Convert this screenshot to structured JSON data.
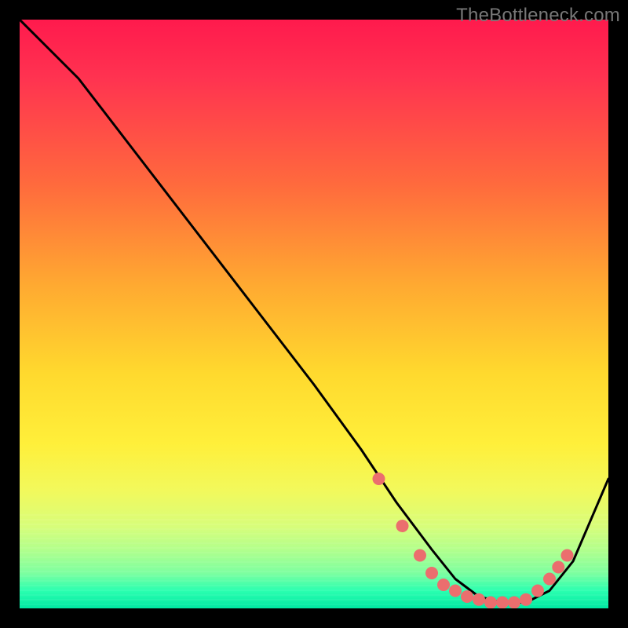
{
  "watermark": "TheBottleneck.com",
  "chart_data": {
    "type": "line",
    "title": "",
    "xlabel": "",
    "ylabel": "",
    "xlim": [
      0,
      100
    ],
    "ylim": [
      0,
      100
    ],
    "background_gradient": {
      "top": "#ff1a4d",
      "mid": "#ffd92e",
      "bottom": "#00e8a2",
      "description": "vertical red-to-green heatmap background"
    },
    "series": [
      {
        "name": "bottleneck-curve",
        "color": "#000000",
        "x": [
          0,
          4,
          10,
          20,
          30,
          40,
          50,
          58,
          64,
          70,
          74,
          78,
          82,
          86,
          90,
          94,
          100
        ],
        "y": [
          100,
          96,
          90,
          77,
          64,
          51,
          38,
          27,
          18,
          10,
          5,
          2,
          1,
          1,
          3,
          8,
          22
        ]
      }
    ],
    "markers": {
      "name": "highlight-dots",
      "color": "#eb6e6e",
      "points": [
        {
          "x": 61,
          "y": 22
        },
        {
          "x": 65,
          "y": 14
        },
        {
          "x": 68,
          "y": 9
        },
        {
          "x": 70,
          "y": 6
        },
        {
          "x": 72,
          "y": 4
        },
        {
          "x": 74,
          "y": 3
        },
        {
          "x": 76,
          "y": 2
        },
        {
          "x": 78,
          "y": 1.5
        },
        {
          "x": 80,
          "y": 1
        },
        {
          "x": 82,
          "y": 1
        },
        {
          "x": 84,
          "y": 1
        },
        {
          "x": 86,
          "y": 1.5
        },
        {
          "x": 88,
          "y": 3
        },
        {
          "x": 90,
          "y": 5
        },
        {
          "x": 91.5,
          "y": 7
        },
        {
          "x": 93,
          "y": 9
        }
      ]
    }
  }
}
